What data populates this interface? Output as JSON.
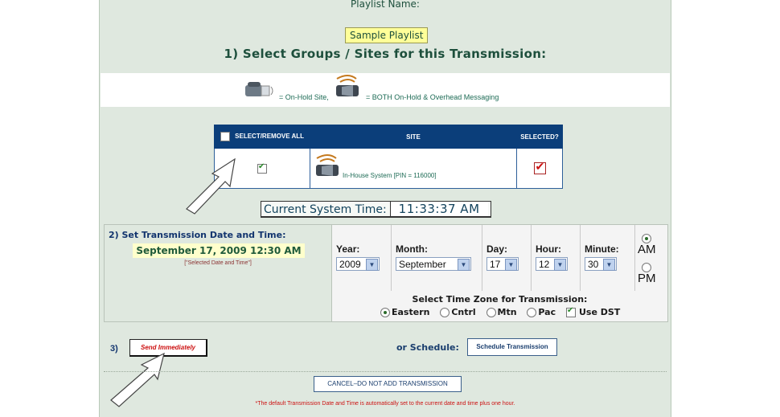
{
  "playlist": {
    "name_label": "Playlist Name:",
    "name_value": "Sample Playlist"
  },
  "step1": {
    "title": "1) Select Groups / Sites for this Transmission:",
    "legend_onhold": "= On-Hold Site,",
    "legend_both": "= BOTH On-Hold & Overhead Messaging",
    "table": {
      "col_select": "SELECT/REMOVE ALL",
      "col_site": "SITE",
      "col_selected": "SELECTED?",
      "rows": [
        {
          "site": "In-House System [PIN = 116000]",
          "checked": true,
          "selected": true
        }
      ]
    }
  },
  "current_time": {
    "label": "Current System Time:",
    "value": "11:33:37 AM"
  },
  "step2": {
    "title": "2) Set Transmission Date and Time:",
    "selected_datetime": "September 17, 2009 12:30 AM",
    "selected_caption": "[\"Selected Date and Time\"]",
    "year_label": "Year:",
    "year_value": "2009",
    "month_label": "Month:",
    "month_value": "September",
    "day_label": "Day:",
    "day_value": "17",
    "hour_label": "Hour:",
    "hour_value": "12",
    "minute_label": "Minute:",
    "minute_value": "30",
    "am_label": "AM",
    "pm_label": "PM",
    "ampm_selected": "AM",
    "tz_title": "Select Time Zone for Transmission:",
    "tz_options": [
      "Eastern",
      "Cntrl",
      "Mtn",
      "Pac"
    ],
    "tz_selected": "Eastern",
    "dst_label": "Use DST",
    "dst_checked": true
  },
  "step3": {
    "num": "3)",
    "send_now": "Send Immediately",
    "or_schedule": "or Schedule:",
    "schedule_button": "Schedule Transmission"
  },
  "cancel_button": "CANCEL–DO NOT ADD TRANSMISSION",
  "footnote": "*The default Transmission Date and Time is automatically set to the current date and time plus one hour."
}
